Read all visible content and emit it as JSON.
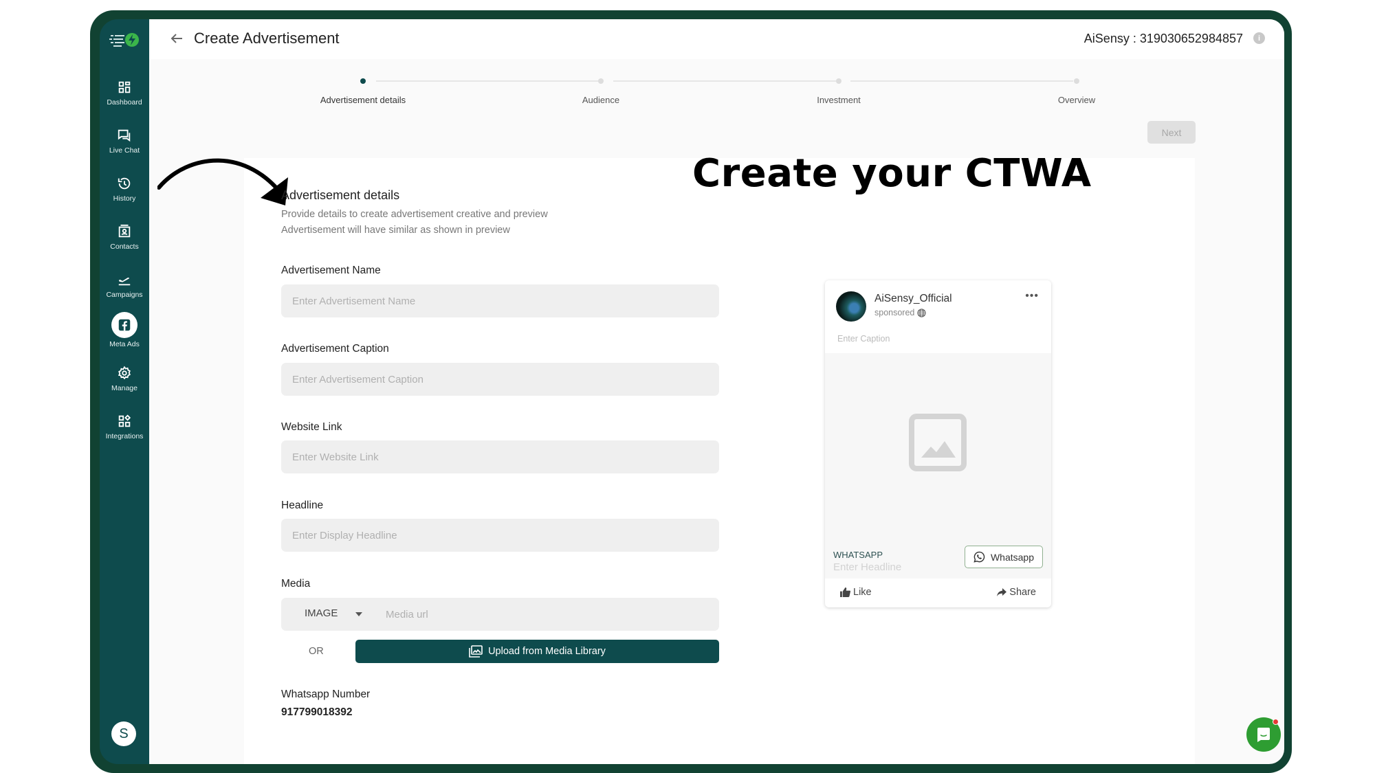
{
  "sidebar": {
    "items": [
      {
        "label": "Dashboard",
        "icon": "dashboard-icon"
      },
      {
        "label": "Live Chat",
        "icon": "chat-icon"
      },
      {
        "label": "History",
        "icon": "history-icon"
      },
      {
        "label": "Contacts",
        "icon": "contacts-icon"
      },
      {
        "label": "Campaigns",
        "icon": "campaign-icon"
      },
      {
        "label": "Meta Ads",
        "icon": "facebook-icon",
        "active": true
      },
      {
        "label": "Manage",
        "icon": "gear-icon"
      },
      {
        "label": "Integrations",
        "icon": "integrations-icon"
      }
    ],
    "user_initial": "S"
  },
  "header": {
    "title": "Create Advertisement",
    "account": "AiSensy : 319030652984857",
    "info_glyph": "i"
  },
  "stepper": {
    "steps": [
      "Advertisement details",
      "Audience",
      "Investment",
      "Overview"
    ],
    "active_index": 0
  },
  "next_label": "Next",
  "promo_text": "Create your CTWA",
  "form": {
    "section_title": "Advertisement details",
    "desc_line1": "Provide details to create advertisement creative and preview",
    "desc_line2": "Advertisement will have similar as shown in preview",
    "fields": [
      {
        "label": "Advertisement Name",
        "placeholder": "Enter Advertisement Name",
        "value": ""
      },
      {
        "label": "Advertisement Caption",
        "placeholder": "Enter Advertisement Caption",
        "value": ""
      },
      {
        "label": "Website Link",
        "placeholder": "Enter Website Link",
        "value": ""
      },
      {
        "label": "Headline",
        "placeholder": "Enter Display Headline",
        "value": ""
      }
    ],
    "media": {
      "label": "Media",
      "type_selected": "IMAGE",
      "url_placeholder": "Media url",
      "or_label": "OR",
      "upload_label": "Upload from Media Library"
    },
    "whatsapp": {
      "label": "Whatsapp Number",
      "value": "917799018392"
    }
  },
  "preview": {
    "account_name": "AiSensy_Official",
    "sponsored": "sponsored",
    "more_glyph": "•••",
    "caption_placeholder": "Enter Caption",
    "channel": "WHATSAPP",
    "headline_placeholder": "Enter Headline",
    "cta_label": "Whatsapp",
    "like_label": "Like",
    "share_label": "Share"
  },
  "colors": {
    "sidebar": "#0e4b4d",
    "frame": "#114232",
    "primary_button": "#0e4b4d",
    "chat_fab": "#2e9d32"
  }
}
